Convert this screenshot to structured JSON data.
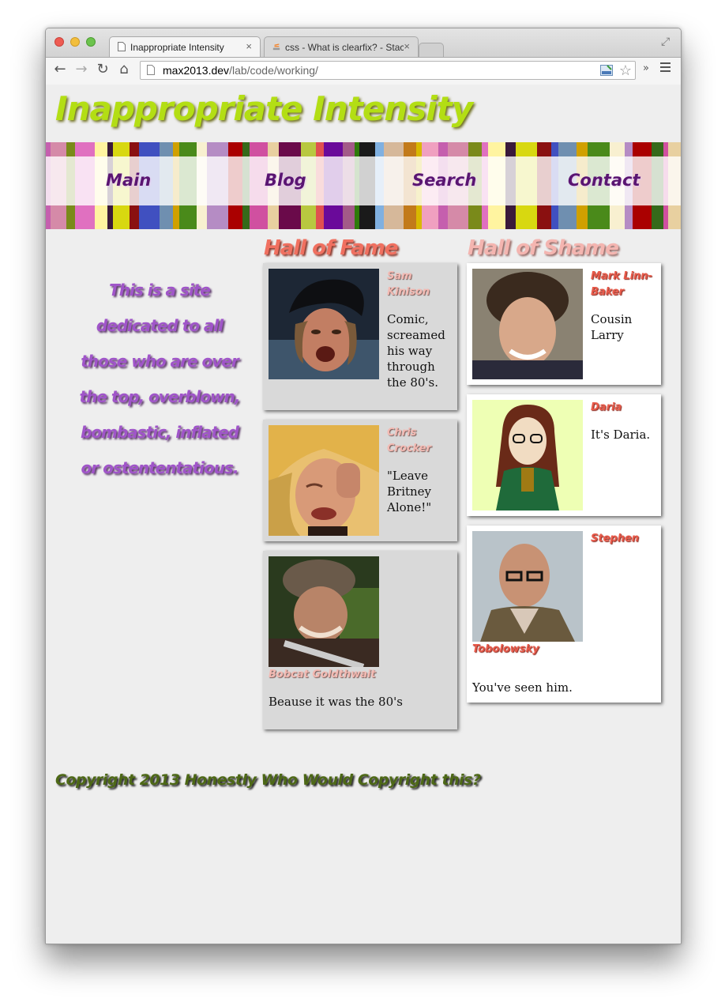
{
  "browser": {
    "tabs": [
      {
        "title": "Inappropriate Intensity",
        "close": "×"
      },
      {
        "title": "css - What is clearfix? - Stack Overflow",
        "close": "×"
      }
    ],
    "url_host": "max2013.dev",
    "url_path": "/lab/code/working/",
    "overflow_label": "»"
  },
  "site": {
    "title": "Inappropriate Intensity",
    "nav": [
      "Main",
      "Blog",
      "Search",
      "Contact"
    ],
    "tagline": "This is a site dedicated to all those who are over the top, overblown, bombastic, inflated or ostententatious."
  },
  "hall_of_fame": {
    "heading": "Hall of Fame",
    "entries": [
      {
        "name": "Sam Kinison",
        "desc": "Comic, screamed his way through the 80's."
      },
      {
        "name": "Chris Crocker",
        "desc": "\"Leave Britney Alone!\""
      },
      {
        "name": "Bobcat Goldthwait",
        "desc": "Beause it was the 80's"
      }
    ]
  },
  "hall_of_shame": {
    "heading": "Hall of Shame",
    "entries": [
      {
        "name": "Mark Linn-Baker",
        "desc": "Cousin Larry"
      },
      {
        "name": "Daria",
        "desc": "It's Daria."
      },
      {
        "name": "Stephen Tobolowsky",
        "desc": "You've seen him."
      }
    ]
  },
  "footer": {
    "text": "Copyright 2013 Honestly Who Would Copyright this?"
  },
  "colors": {
    "title": "#b3de14",
    "nav": "#5a1572",
    "tagline": "#a055c9",
    "fame_heading": "#f07060",
    "shame_heading": "#f4b5b0",
    "footer": "#4d6816"
  },
  "icons": [
    "back-icon",
    "forward-icon",
    "reload-icon",
    "home-icon",
    "page-icon",
    "star-icon",
    "menu-icon",
    "fullscreen-icon"
  ]
}
